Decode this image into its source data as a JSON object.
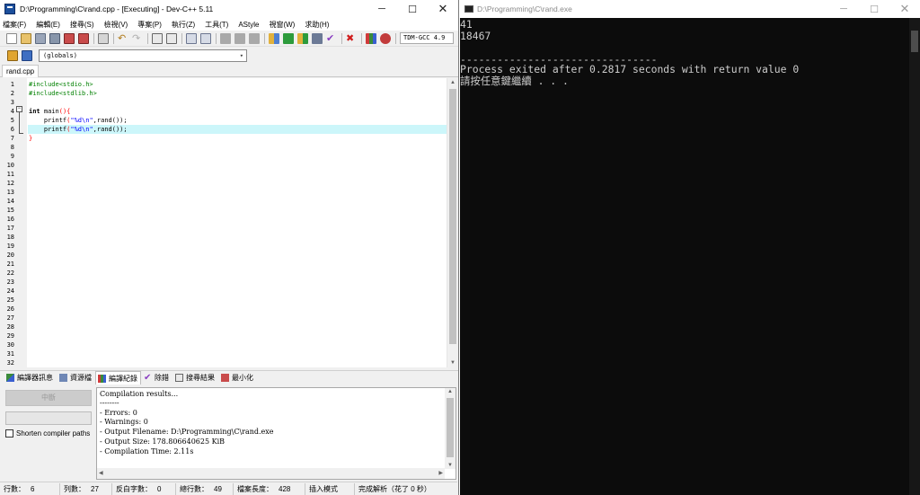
{
  "ide": {
    "title": "D:\\Programming\\C\\rand.cpp - [Executing] - Dev-C++ 5.11",
    "window_controls": {
      "minimize": "─",
      "maximize": "☐",
      "close": "✕"
    },
    "menu": [
      "檔案(F)",
      "編輯(E)",
      "搜尋(S)",
      "檢視(V)",
      "專案(P)",
      "執行(Z)",
      "工具(T)",
      "AStyle",
      "視窗(W)",
      "求助(H)"
    ],
    "compiler_label": "TDM-GCC 4.9",
    "scope_select": "(globals)",
    "file_tab": "rand.cpp",
    "line_numbers": [
      "1",
      "2",
      "3",
      "4",
      "5",
      "6",
      "7",
      "8",
      "9",
      "10",
      "11",
      "12",
      "13",
      "14",
      "15",
      "16",
      "17",
      "18",
      "19",
      "20",
      "21",
      "22",
      "23",
      "24",
      "25",
      "26",
      "27",
      "28",
      "29",
      "30",
      "31",
      "32"
    ],
    "current_line": 6,
    "code": {
      "line1": "#include<stdio.h>",
      "line2": "#include<stdlib.h>",
      "line4_kw": "int",
      "line4_name": " main",
      "line4_sym": "(){",
      "line5_indent": "    printf",
      "line5_open": "(",
      "line5_str": "\"%d\\n\"",
      "line5_rest": ",rand());",
      "line6_indent": "    printf",
      "line6_open": "(",
      "line6_str": "\"%d\\n\"",
      "line6_rest": ",rand());",
      "line7": "}"
    },
    "bottom_tabs": [
      "編譯器訊息",
      "資源檔",
      "編譯紀錄",
      "除錯",
      "搜尋結果",
      "最小化"
    ],
    "active_bottom_tab": "編譯紀錄",
    "abort_button": "中斷",
    "shorten_paths": {
      "label": "Shorten compiler paths",
      "checked": false
    },
    "compile_log": [
      "Compilation results...",
      "--------",
      "- Errors: 0",
      "- Warnings: 0",
      "- Output Filename: D:\\Programming\\C\\rand.exe",
      "- Output Size: 178.806640625 KiB",
      "- Compilation Time: 2.11s"
    ],
    "status": {
      "line_label": "行數：",
      "line_value": "6",
      "col_label": "列數：",
      "col_value": "27",
      "sel_label": "反白字數：",
      "sel_value": "0",
      "total_label": "總行數：",
      "total_value": "49",
      "length_label": "檔案長度：",
      "length_value": "428",
      "mode": "插入模式",
      "parse": "完成解析（花了 0 秒）"
    },
    "colors": {
      "accent_line": "#ccf6fa",
      "preprocessor": "#008000",
      "symbol": "#ff0000",
      "string": "#0000ff"
    }
  },
  "console": {
    "title": "D:\\Programming\\C\\rand.exe",
    "window_controls": {
      "minimize": "─",
      "maximize": "☐",
      "close": "✕"
    },
    "lines": [
      "41",
      "18467",
      "",
      "--------------------------------",
      "Process exited after 0.2817 seconds with return value 0",
      "請按任意鍵繼續 . . ."
    ]
  }
}
